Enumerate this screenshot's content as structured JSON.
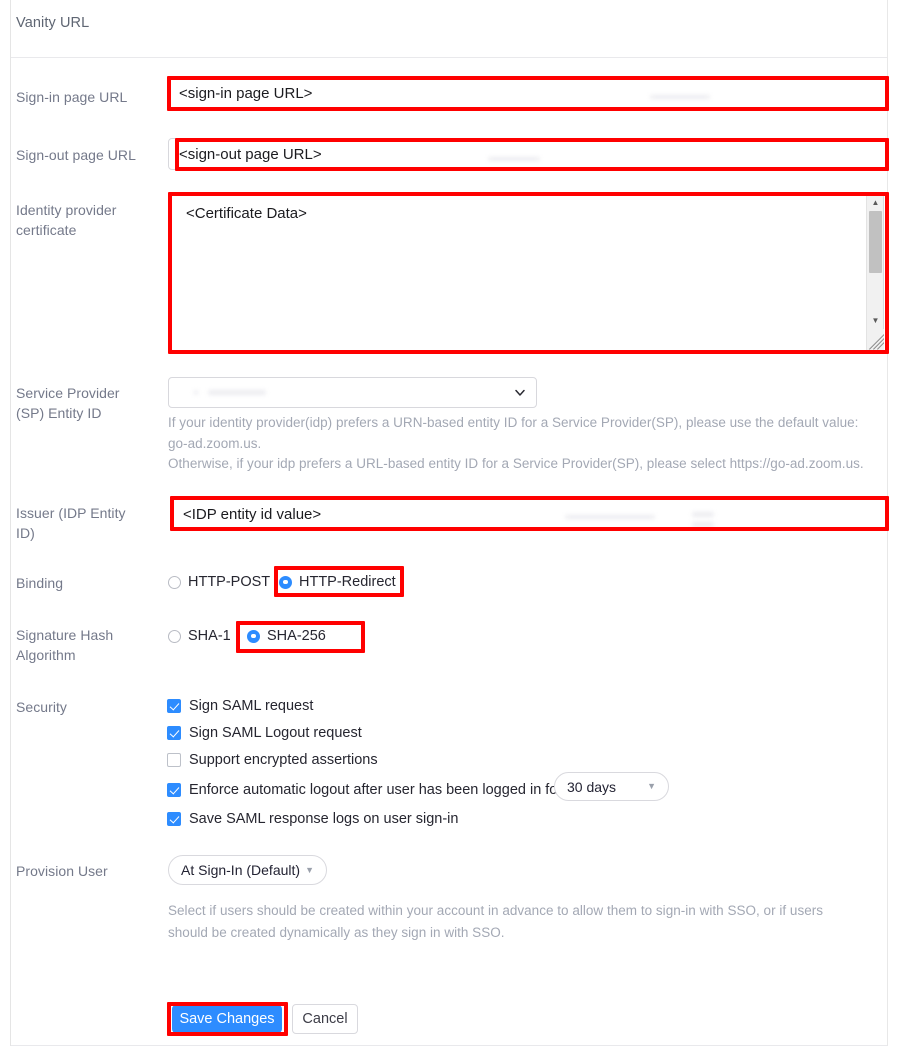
{
  "header": {
    "title": "Vanity URL"
  },
  "fields": {
    "signin": {
      "label": "Sign-in page URL",
      "value": "<sign-in page URL>"
    },
    "signout": {
      "label": "Sign-out page URL",
      "value": "<sign-out page URL>"
    },
    "certificate": {
      "label": "Identity provider certificate",
      "value": "<Certificate Data>"
    },
    "sp_entity": {
      "label": "Service Provider (SP) Entity ID",
      "value": "",
      "help_line_1": "If your identity provider(idp) prefers a URN-based entity ID for a Service Provider(SP), please use the default value: go-ad.zoom.us.",
      "help_line_2": "Otherwise, if your idp prefers a URL-based entity ID for a Service Provider(SP), please select https://go-ad.zoom.us."
    },
    "issuer": {
      "label": "Issuer (IDP Entity ID)",
      "value": "<IDP entity id value>"
    },
    "binding": {
      "label": "Binding",
      "options": [
        {
          "label": "HTTP-POST",
          "selected": false
        },
        {
          "label": "HTTP-Redirect",
          "selected": true
        }
      ]
    },
    "signature_hash": {
      "label": "Signature Hash Algorithm",
      "options": [
        {
          "label": "SHA-1",
          "selected": false
        },
        {
          "label": "SHA-256",
          "selected": true
        }
      ]
    },
    "security": {
      "label": "Security",
      "items": [
        {
          "label": "Sign SAML request",
          "checked": true
        },
        {
          "label": "Sign SAML Logout request",
          "checked": true
        },
        {
          "label": "Support encrypted assertions",
          "checked": false
        },
        {
          "label": "Enforce automatic logout after user has been logged in for",
          "checked": true
        },
        {
          "label": "Save SAML response logs on user sign-in",
          "checked": true
        }
      ],
      "logout_duration": "30 days"
    },
    "provision_user": {
      "label": "Provision User",
      "value": "At Sign-In (Default)",
      "help_line_1": "Select if users should be created within your account in advance to allow them to sign-in with SSO, or if users",
      "help_line_2": "should be created dynamically as they sign in with SSO."
    }
  },
  "footer": {
    "save_label": "Save Changes",
    "cancel_label": "Cancel"
  },
  "colors": {
    "accent": "#2d8cff",
    "annotation": "#ff0000",
    "label_gray": "#74798a",
    "help_gray": "#a3a8b4"
  }
}
